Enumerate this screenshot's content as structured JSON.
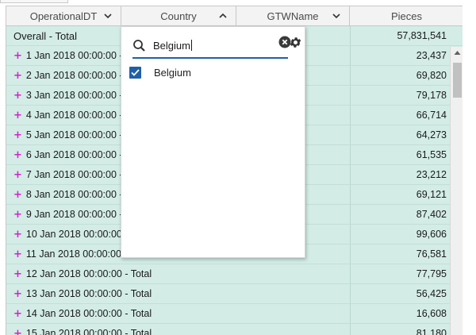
{
  "header": {
    "columns": [
      {
        "label": "OperationalDT",
        "has_menu": true,
        "menu_icon": "chevron-down-icon"
      },
      {
        "label": "Country",
        "has_menu": true,
        "menu_icon": "chevron-up-icon"
      },
      {
        "label": "GTWName",
        "has_menu": true,
        "menu_icon": "chevron-down-icon"
      },
      {
        "label": "Pieces",
        "has_menu": false
      }
    ]
  },
  "rows": [
    {
      "label": "Overall - Total",
      "value": "57,831,541",
      "expandable": false
    },
    {
      "label": "1 Jan 2018 00:00:00 - Total",
      "value": "23,437",
      "expandable": true
    },
    {
      "label": "2 Jan 2018 00:00:00 - Total",
      "value": "69,820",
      "expandable": true
    },
    {
      "label": "3 Jan 2018 00:00:00 - Total",
      "value": "79,178",
      "expandable": true
    },
    {
      "label": "4 Jan 2018 00:00:00 - Total",
      "value": "66,714",
      "expandable": true
    },
    {
      "label": "5 Jan 2018 00:00:00 - Total",
      "value": "64,273",
      "expandable": true
    },
    {
      "label": "6 Jan 2018 00:00:00 - Total",
      "value": "61,535",
      "expandable": true
    },
    {
      "label": "7 Jan 2018 00:00:00 - Total",
      "value": "23,212",
      "expandable": true
    },
    {
      "label": "8 Jan 2018 00:00:00 - Total",
      "value": "69,121",
      "expandable": true
    },
    {
      "label": "9 Jan 2018 00:00:00 - Total",
      "value": "87,402",
      "expandable": true
    },
    {
      "label": "10 Jan 2018 00:00:00 - Total",
      "value": "99,606",
      "expandable": true
    },
    {
      "label": "11 Jan 2018 00:00:00 - Total",
      "value": "76,581",
      "expandable": true
    },
    {
      "label": "12 Jan 2018 00:00:00 - Total",
      "value": "77,795",
      "expandable": true
    },
    {
      "label": "13 Jan 2018 00:00:00 - Total",
      "value": "56,425",
      "expandable": true
    },
    {
      "label": "14 Jan 2018 00:00:00 - Total",
      "value": "16,608",
      "expandable": true
    },
    {
      "label": "15 Jan 2018 00:00:00 - Total",
      "value": "81,180",
      "expandable": true
    }
  ],
  "expand_symbol": "+",
  "filter_popup": {
    "search_value": "Belgium",
    "search_icon": "search-icon",
    "clear_icon": "clear-circle-icon",
    "settings_icon": "gear-icon",
    "options": [
      {
        "label": "Belgium",
        "checked": true
      }
    ]
  },
  "colors": {
    "row_background": "#d3ece6",
    "expand_plus": "#d61fd0",
    "accent_blue": "#1f5fa8",
    "header_background": "#f3f3f3"
  }
}
